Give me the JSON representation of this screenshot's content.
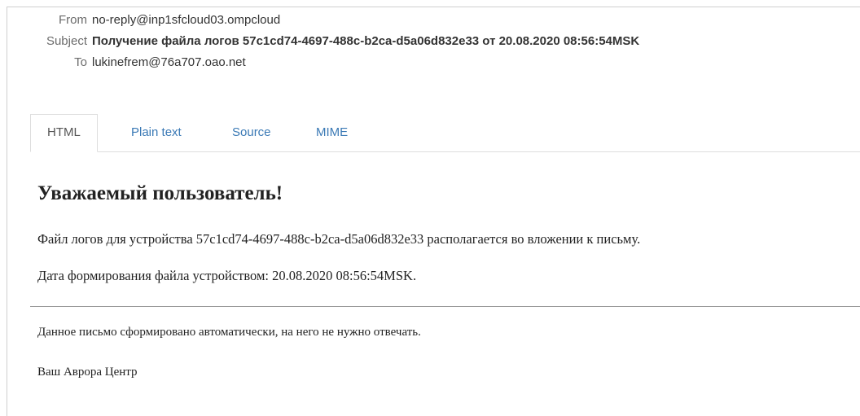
{
  "headers": {
    "from_label": "From",
    "from_value": "no-reply@inp1sfcloud03.ompcloud",
    "subject_label": "Subject",
    "subject_value": "Получение файла логов 57c1cd74-4697-488c-b2ca-d5a06d832e33 от 20.08.2020 08:56:54MSK",
    "to_label": "To",
    "to_value": "lukinefrem@76a707.oao.net"
  },
  "tabs": [
    {
      "label": "HTML",
      "active": true
    },
    {
      "label": "Plain text",
      "active": false
    },
    {
      "label": "Source",
      "active": false
    },
    {
      "label": "MIME",
      "active": false
    }
  ],
  "body": {
    "greeting": "Уважаемый пользователь!",
    "line1": "Файл логов для устройства 57c1cd74-4697-488c-b2ca-d5a06d832e33 располагается во вложении к письму.",
    "line2": "Дата формирования файла устройством: 20.08.2020 08:56:54MSK."
  },
  "footer": {
    "note": "Данное письмо сформировано автоматически, на него не нужно отвечать.",
    "signature": "Ваш Аврора Центр"
  },
  "colors": {
    "link": "#3a79b5",
    "label": "#6b6b6b",
    "text": "#222222",
    "border": "#dddddd"
  }
}
